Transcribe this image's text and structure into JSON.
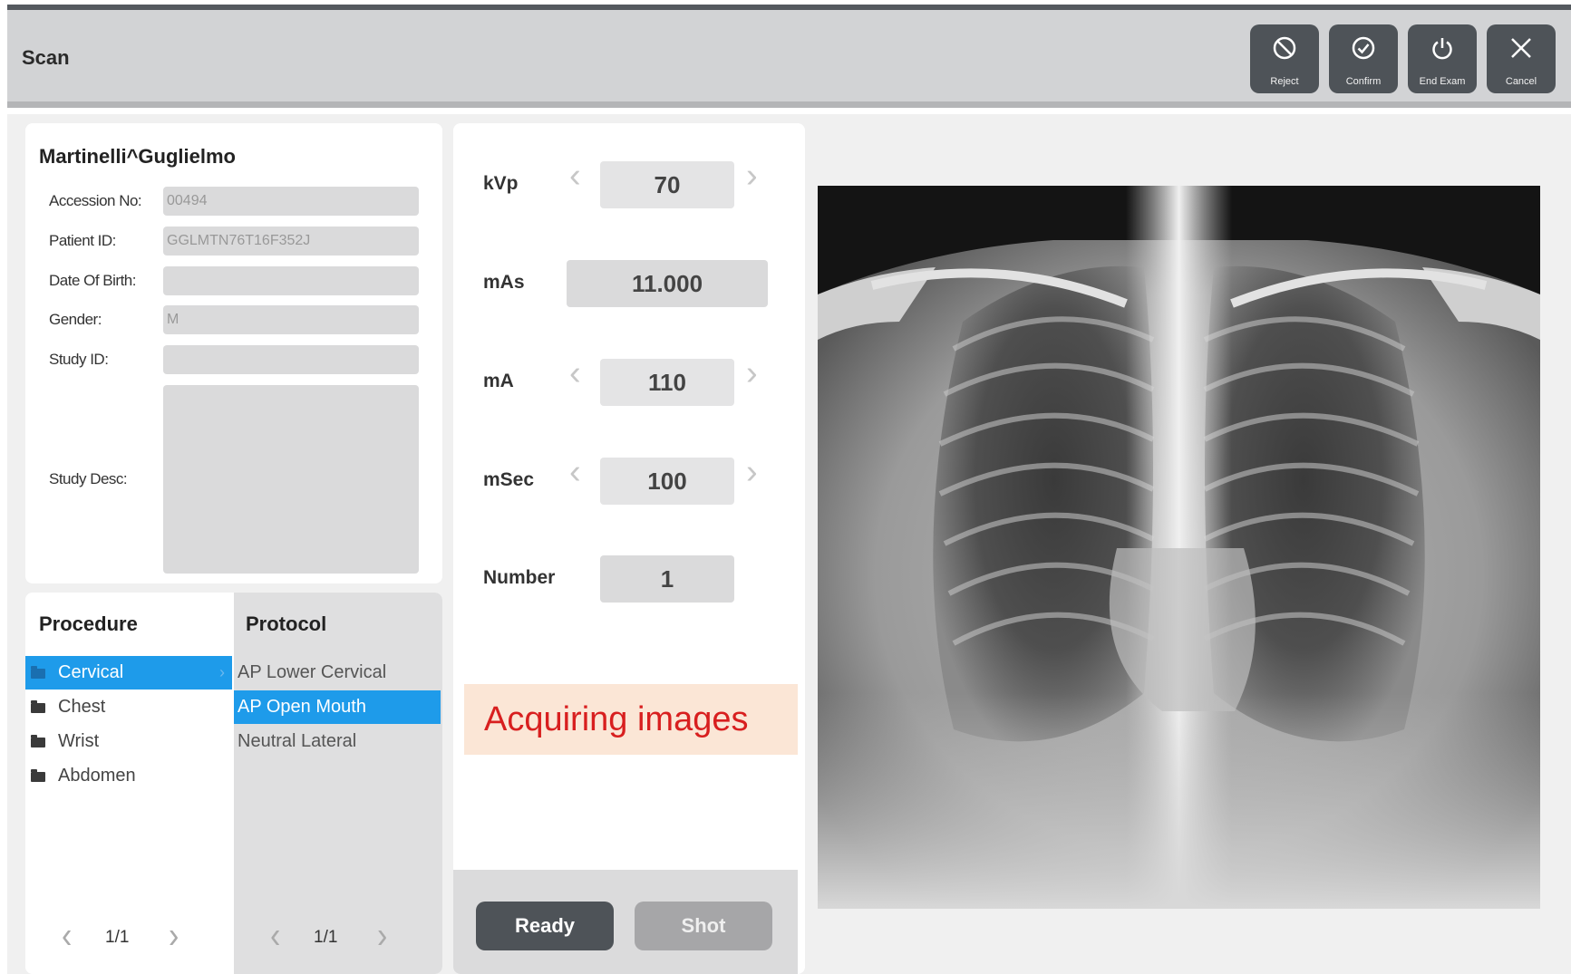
{
  "header": {
    "title": "Scan",
    "buttons": [
      {
        "label": "Reject",
        "icon": "reject-icon"
      },
      {
        "label": "Confirm",
        "icon": "confirm-check-icon"
      },
      {
        "label": "End Exam",
        "icon": "power-icon"
      },
      {
        "label": "Cancel",
        "icon": "close-icon"
      }
    ]
  },
  "patient": {
    "name": "Martinelli^Guglielmo",
    "fields": [
      {
        "label": "Accession No:",
        "value": "00494"
      },
      {
        "label": "Patient ID:",
        "value": "GGLMTN76T16F352J"
      },
      {
        "label": "Date Of Birth:",
        "value": ""
      },
      {
        "label": "Gender:",
        "value": "M"
      },
      {
        "label": "Study ID:",
        "value": ""
      },
      {
        "label": "Study Desc:",
        "value": ""
      }
    ]
  },
  "procedure": {
    "title": "Procedure",
    "items": [
      "Cervical",
      "Chest",
      "Wrist",
      "Abdomen"
    ],
    "selected": "Cervical",
    "page": "1/1"
  },
  "protocol": {
    "title": "Protocol",
    "items": [
      "AP Lower Cervical",
      "AP Open Mouth",
      "Neutral Lateral"
    ],
    "selected": "AP Open Mouth",
    "page": "1/1"
  },
  "params": {
    "kvp": {
      "label": "kVp",
      "value": "70"
    },
    "mas": {
      "label": "mAs",
      "value": "11.000"
    },
    "ma": {
      "label": "mA",
      "value": "110"
    },
    "msec": {
      "label": "mSec",
      "value": "100"
    },
    "number": {
      "label": "Number",
      "value": "1"
    }
  },
  "status": "Acquiring images",
  "actions": {
    "ready": "Ready",
    "shot": "Shot"
  },
  "colors": {
    "accent": "#1e9bea",
    "header_button": "#4e5358",
    "status_text": "#d81f1f",
    "status_bg": "#fbe6d6",
    "ready_button": "#4e5358",
    "shot_button": "#a6a6a8"
  }
}
